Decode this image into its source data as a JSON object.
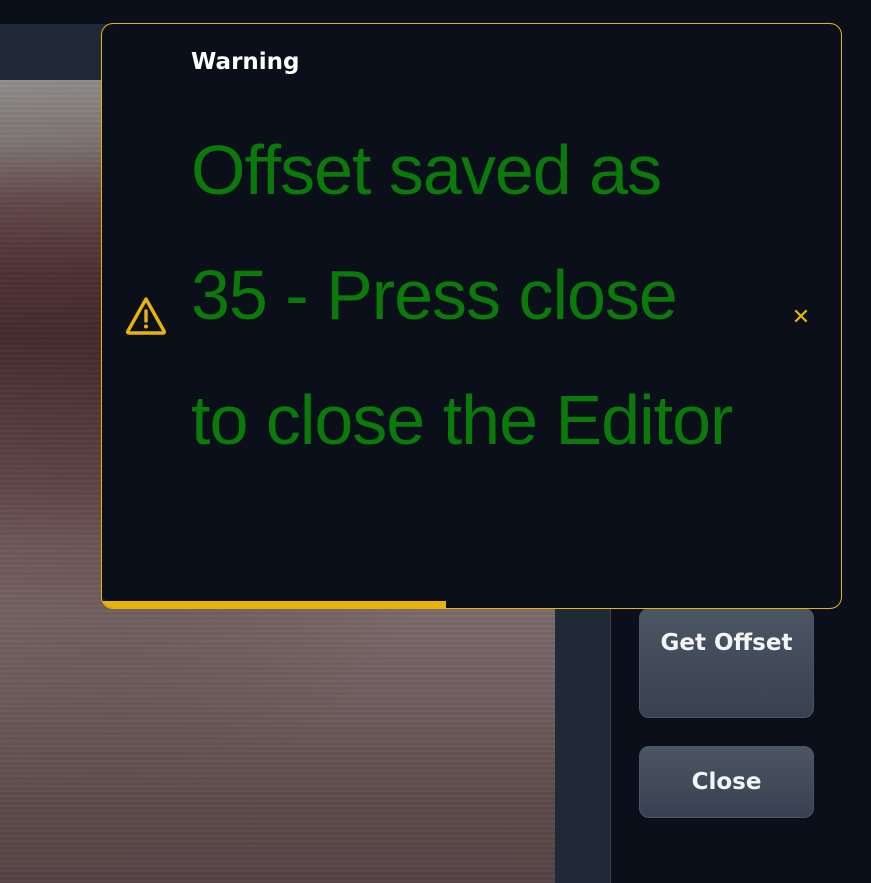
{
  "toast": {
    "level": "warning",
    "title": "Warning",
    "message": "Offset saved as 35 - Press close to close the Editor",
    "icon": "warning-triangle-icon",
    "close_icon": "close-icon",
    "close_glyph": "✕",
    "accent_color": "#eab308",
    "message_color": "#0a7a0a",
    "progress_fraction": 0.465
  },
  "sidebar": {
    "get_offset_label": "Get Offset",
    "close_label": "Close"
  }
}
